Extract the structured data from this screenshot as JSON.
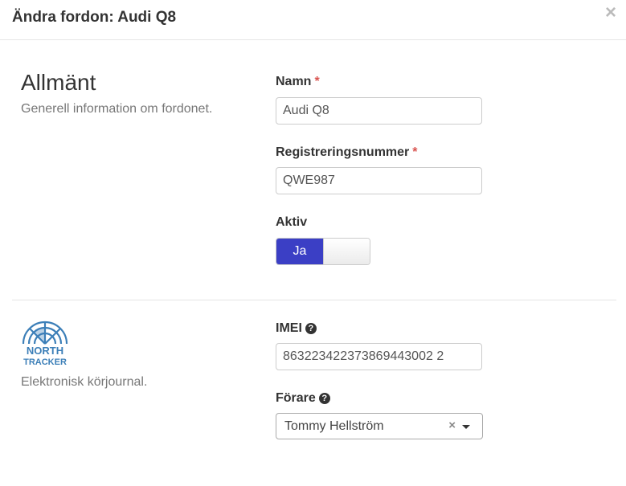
{
  "modal": {
    "title": "Ändra fordon: Audi Q8",
    "close_icon": "×"
  },
  "general": {
    "title": "Allmänt",
    "description": "Generell information om fordonet.",
    "name_label": "Namn",
    "name_value": "Audi Q8",
    "reg_label": "Registreringsnummer",
    "reg_value": "QWE987",
    "required_mark": "*",
    "active_label": "Aktiv",
    "active_on_label": "Ja"
  },
  "integration": {
    "logo_line1": "NORTH",
    "logo_line2": "TRACKER",
    "description": "Elektronisk körjournal.",
    "imei_label": "IMEI",
    "imei_value": "863223422373869443002 2",
    "driver_label": "Förare",
    "driver_value": "Tommy Hellström",
    "clear_icon": "×",
    "help_icon": "?"
  },
  "colors": {
    "toggle_on": "#3b3fc5",
    "required": "#d9534f",
    "logo_blue": "#3c7fb8"
  }
}
